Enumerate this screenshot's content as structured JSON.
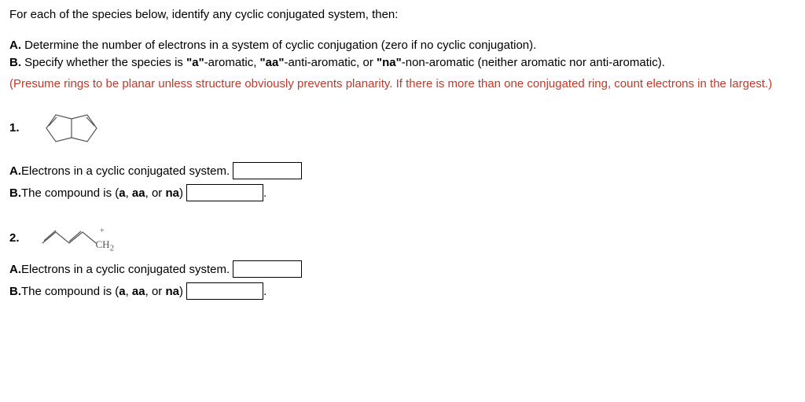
{
  "intro": "For each of the species below, identify any cyclic conjugated system, then:",
  "optionA": {
    "label": "A.",
    "text": " Determine the number of electrons in a system of cyclic conjugation (zero if no cyclic conjugation)."
  },
  "optionB": {
    "label": "B.",
    "text1": " Specify whether the species is ",
    "a_bold": "\"a\"",
    "a_text": "-aromatic, ",
    "aa_bold": "\"aa\"",
    "aa_text": "-anti-aromatic, or ",
    "na_bold": "\"na\"",
    "na_text": "-non-aromatic (neither aromatic nor anti-aromatic)."
  },
  "hint": "(Presume rings to be planar unless structure obviously prevents planarity. If there is more than one conjugated ring, count electrons in the largest.)",
  "q1": {
    "number": "1.",
    "answerA_label": "A.",
    "answerA_text": "Electrons in a cyclic conjugated system.",
    "answerB_label": "B.",
    "answerB_text1": "The compound is (",
    "answerB_a": "a",
    "answerB_sep1": ", ",
    "answerB_aa": "aa",
    "answerB_sep2": ", or ",
    "answerB_na": "na",
    "answerB_close": ")",
    "answerB_period": "."
  },
  "q2": {
    "number": "2.",
    "ch2_text": "CH",
    "ch2_sub": "2",
    "answerA_label": "A.",
    "answerA_text": "Electrons in a cyclic conjugated system.",
    "answerB_label": "B.",
    "answerB_text1": "The compound is (",
    "answerB_a": "a",
    "answerB_sep1": ", ",
    "answerB_aa": "aa",
    "answerB_sep2": ", or ",
    "answerB_na": "na",
    "answerB_close": ")",
    "answerB_period": "."
  }
}
